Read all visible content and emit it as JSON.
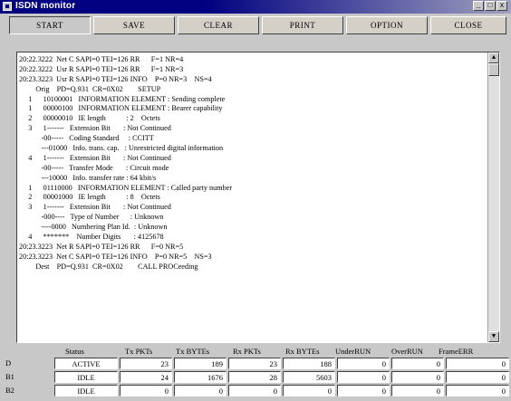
{
  "window": {
    "title": "ISDN monitor",
    "controls": [
      "_",
      "□",
      "x"
    ]
  },
  "toolbar": {
    "buttons": [
      {
        "label": "START"
      },
      {
        "label": "SAVE"
      },
      {
        "label": "CLEAR"
      },
      {
        "label": "PRINT"
      },
      {
        "label": "OPTION"
      },
      {
        "label": "CLOSE"
      }
    ]
  },
  "log": {
    "lines": [
      "20:22.3222  Net C SAPI=0 TEI=126 RR      F=1 NR=4",
      "20:22.3222  Usr R SAPI=0 TEI=126 RR      F=1 NR=3",
      "20:23.3223  Usr R SAPI=0 TEI=126 INFO    P=0 NR=3    NS=4",
      "         Orig    PD=Q.931  CR=0X02        SETUP",
      "     1      10100001   INFORMATION ELEMENT : Sending complete",
      "     1      00000100   INFORMATION ELEMENT : Bearer capability",
      "     2      00000010   IE length           : 2    Octets",
      "     3      1-------   Extension Bit       : Not Continued",
      "            -00-----   Coding Standard     : CCITT",
      "            ---01000   Info. trans. cap.   : Unrestricted digital information",
      "     4      1-------   Extension Bit       : Not Continued",
      "            -00-----   Transfer Mode       : Circuit mode",
      "            ---10000   Info. transfer rate : 64 kbit/s",
      "     1      01110000   INFORMATION ELEMENT : Called party number",
      "     2      00001000   IE length           : 8    Octets",
      "     3      1-------   Extension Bit       : Not Continued",
      "            -000----   Type of Number      : Unknown",
      "            ----0000   Numbering Plan Id.  : Unknown",
      "     4      *******    Number Digits       : 4125678",
      "20:23.3223  Net R SAPI=0 TEI=126 RR      F=0 NR=5",
      "20:23.3223  Net C SAPI=0 TEI=126 INFO    P=0 NR=5    NS=3",
      "         Dest    PD=Q.931  CR=0X02        CALL PROCeeding"
    ],
    "scroll_up": "▲",
    "scroll_down": "▼"
  },
  "stats": {
    "headers": [
      "Status",
      "Tx PKTs",
      "Tx BYTEs",
      "Rx PKTs",
      "Rx BYTEs",
      "UnderRUN",
      "OverRUN",
      "FrameERR"
    ],
    "rows": [
      {
        "label": "D",
        "cells": [
          "ACTIVE",
          "23",
          "189",
          "23",
          "188",
          "0",
          "0",
          "0"
        ]
      },
      {
        "label": "B1",
        "cells": [
          "IDLE",
          "24",
          "1676",
          "28",
          "5603",
          "0",
          "0",
          "0"
        ]
      },
      {
        "label": "B2",
        "cells": [
          "IDLE",
          "0",
          "0",
          "0",
          "0",
          "0",
          "0",
          "0"
        ]
      }
    ]
  }
}
